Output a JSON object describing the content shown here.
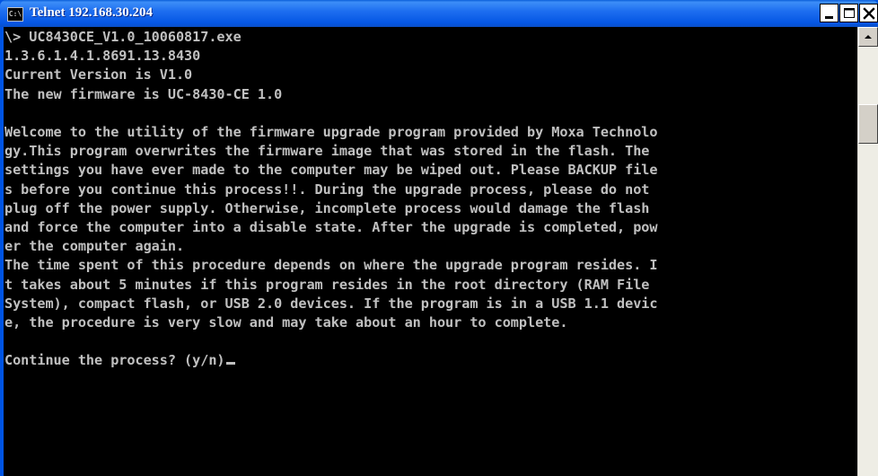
{
  "window": {
    "title": "Telnet 192.168.30.204",
    "icon_label": "C:\\"
  },
  "console": {
    "lines": [
      "\\> UC8430CE_V1.0_10060817.exe",
      "1.3.6.1.4.1.8691.13.8430",
      "Current Version is V1.0",
      "The new firmware is UC-8430-CE 1.0",
      "",
      "Welcome to the utility of the firmware upgrade program provided by Moxa Technolo",
      "gy.This program overwrites the firmware image that was stored in the flash. The",
      "settings you have ever made to the computer may be wiped out. Please BACKUP file",
      "s before you continue this process!!. During the upgrade process, please do not",
      "plug off the power supply. Otherwise, incomplete process would damage the flash",
      "and force the computer into a disable state. After the upgrade is completed, pow",
      "er the computer again.",
      "The time spent of this procedure depends on where the upgrade program resides. I",
      "t takes about 5 minutes if this program resides in the root directory (RAM File",
      "System), compact flash, or USB 2.0 devices. If the program is in a USB 1.1 devic",
      "e, the procedure is very slow and may take about an hour to complete.",
      ""
    ],
    "prompt": "Continue the process? (y/n)"
  },
  "colors": {
    "titlebar": "#0054e3",
    "console_bg": "#000000",
    "console_fg": "#c0c0c0"
  },
  "icons": {
    "app": "console-icon",
    "minimize": "minimize-icon",
    "maximize": "maximize-icon",
    "close": "close-icon",
    "scroll_up": "arrow-up-icon"
  }
}
